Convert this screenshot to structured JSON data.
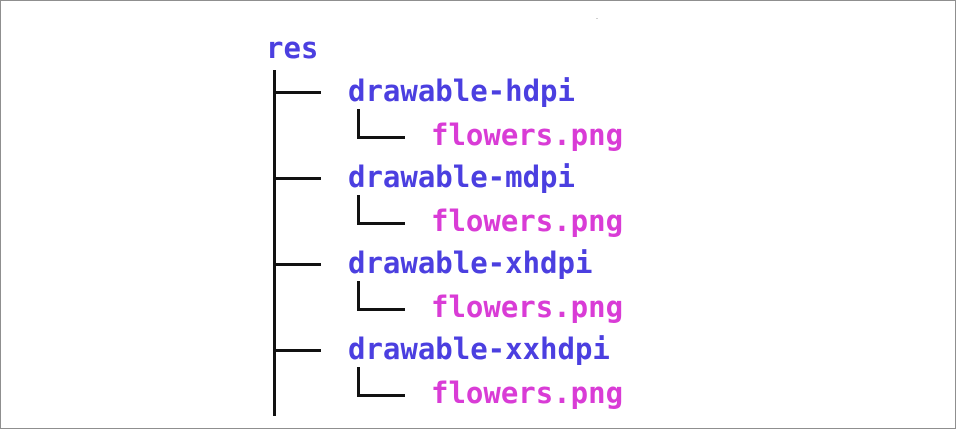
{
  "tree": {
    "root": "res",
    "folders": [
      {
        "name": "drawable-hdpi",
        "file": "flowers.png"
      },
      {
        "name": "drawable-mdpi",
        "file": "flowers.png"
      },
      {
        "name": "drawable-xhdpi",
        "file": "flowers.png"
      },
      {
        "name": "drawable-xxhdpi",
        "file": "flowers.png"
      }
    ]
  },
  "colors": {
    "folder": "#4b3fe0",
    "file": "#d93cd6",
    "lines": "#111111"
  }
}
